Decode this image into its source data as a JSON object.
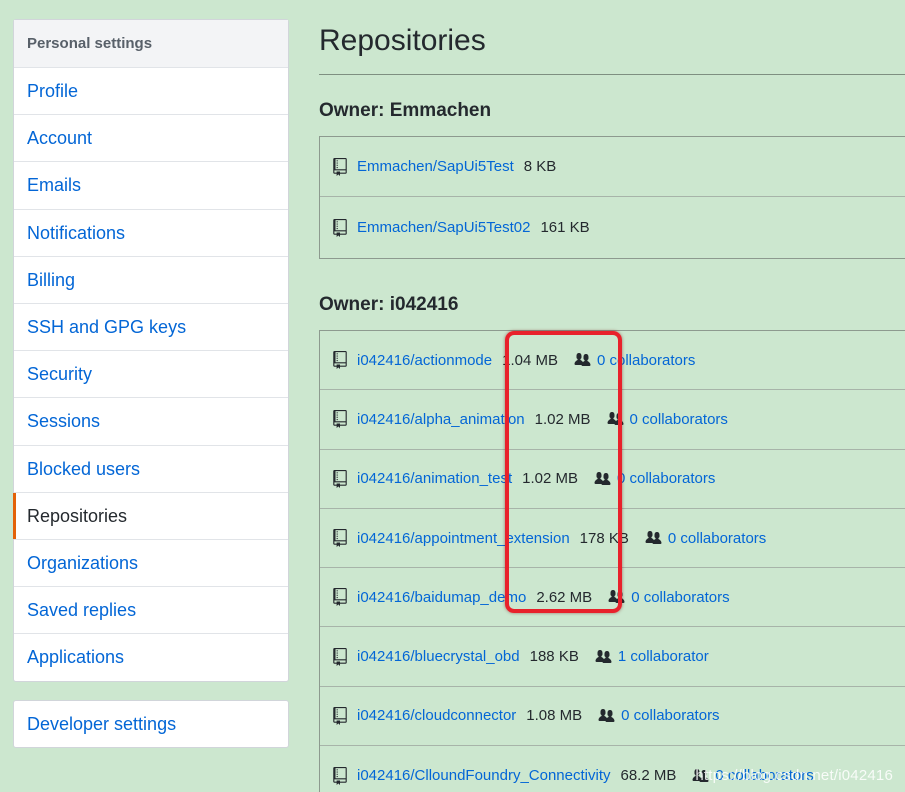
{
  "sidebar": {
    "heading": "Personal settings",
    "items": [
      {
        "label": "Profile"
      },
      {
        "label": "Account"
      },
      {
        "label": "Emails"
      },
      {
        "label": "Notifications"
      },
      {
        "label": "Billing"
      },
      {
        "label": "SSH and GPG keys"
      },
      {
        "label": "Security"
      },
      {
        "label": "Sessions"
      },
      {
        "label": "Blocked users"
      },
      {
        "label": "Repositories",
        "selected": true
      },
      {
        "label": "Organizations"
      },
      {
        "label": "Saved replies"
      },
      {
        "label": "Applications"
      }
    ],
    "developer": "Developer settings",
    "selected_color": "#e36209"
  },
  "main": {
    "title": "Repositories",
    "owners": [
      {
        "label": "Owner: Emmachen",
        "repos": [
          {
            "name": "Emmachen/SapUi5Test",
            "size": "8 KB"
          },
          {
            "name": "Emmachen/SapUi5Test02",
            "size": "161 KB"
          }
        ]
      },
      {
        "label": "Owner: i042416",
        "repos": [
          {
            "name": "i042416/actionmode",
            "size": "1.04 MB",
            "collaborators": "0 collaborators"
          },
          {
            "name": "i042416/alpha_animation",
            "size": "1.02 MB",
            "collaborators": "0 collaborators"
          },
          {
            "name": "i042416/animation_test",
            "size": "1.02 MB",
            "collaborators": "0 collaborators"
          },
          {
            "name": "i042416/appointment_extension",
            "size": "178 KB",
            "collaborators": "0 collaborators"
          },
          {
            "name": "i042416/baidumap_demo",
            "size": "2.62 MB",
            "collaborators": "0 collaborators"
          },
          {
            "name": "i042416/bluecrystal_obd",
            "size": "188 KB",
            "collaborators": "1 collaborator"
          },
          {
            "name": "i042416/cloudconnector",
            "size": "1.08 MB",
            "collaborators": "0 collaborators"
          },
          {
            "name": "i042416/ClloundFoundry_Connectivity",
            "size": "68.2 MB",
            "collaborators": "0 collaborators"
          }
        ]
      }
    ]
  },
  "watermark": "https://blog.csdn.net/i042416",
  "colors": {
    "background": "#cce7cf",
    "link": "#0366d6",
    "highlight": "#e8212b"
  }
}
